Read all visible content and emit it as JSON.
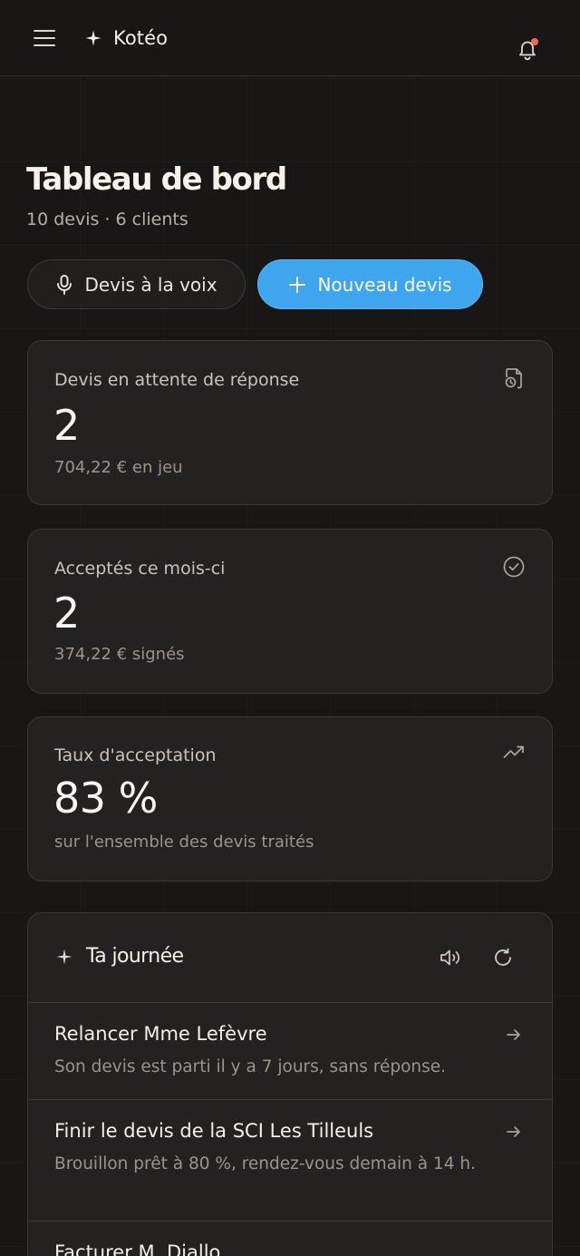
{
  "header": {
    "brand_name": "Kotéo"
  },
  "dashboard": {
    "title": "Tableau de bord",
    "subtitle": "10 devis · 6 clients"
  },
  "actions": {
    "voice_label": "Devis à la voix",
    "new_label": "Nouveau devis"
  },
  "stats": [
    {
      "label": "Devis en attente de réponse",
      "value": "2",
      "sub": "704,22 € en jeu",
      "icon": "file-clock-icon"
    },
    {
      "label": "Acceptés ce mois-ci",
      "value": "2",
      "sub": "374,22 € signés",
      "icon": "check-circle-icon"
    },
    {
      "label": "Taux d'acceptation",
      "value": "83 %",
      "sub": "sur l'ensemble des devis traités",
      "icon": "trending-up-icon"
    }
  ],
  "day": {
    "title": "Ta journée",
    "tasks": [
      {
        "title": "Relancer Mme Lefèvre",
        "desc": "Son devis est parti il y a 7 jours, sans réponse."
      },
      {
        "title": "Finir le devis de la SCI Les Tilleuls",
        "desc": "Brouillon prêt à 80 %, rendez-vous demain à 14 h."
      },
      {
        "title": "Facturer M. Diallo",
        "desc": ""
      }
    ]
  },
  "colors": {
    "background": "#191715",
    "card": "#242220",
    "accent": "#3fa5ef",
    "notification": "#ef6a54"
  }
}
